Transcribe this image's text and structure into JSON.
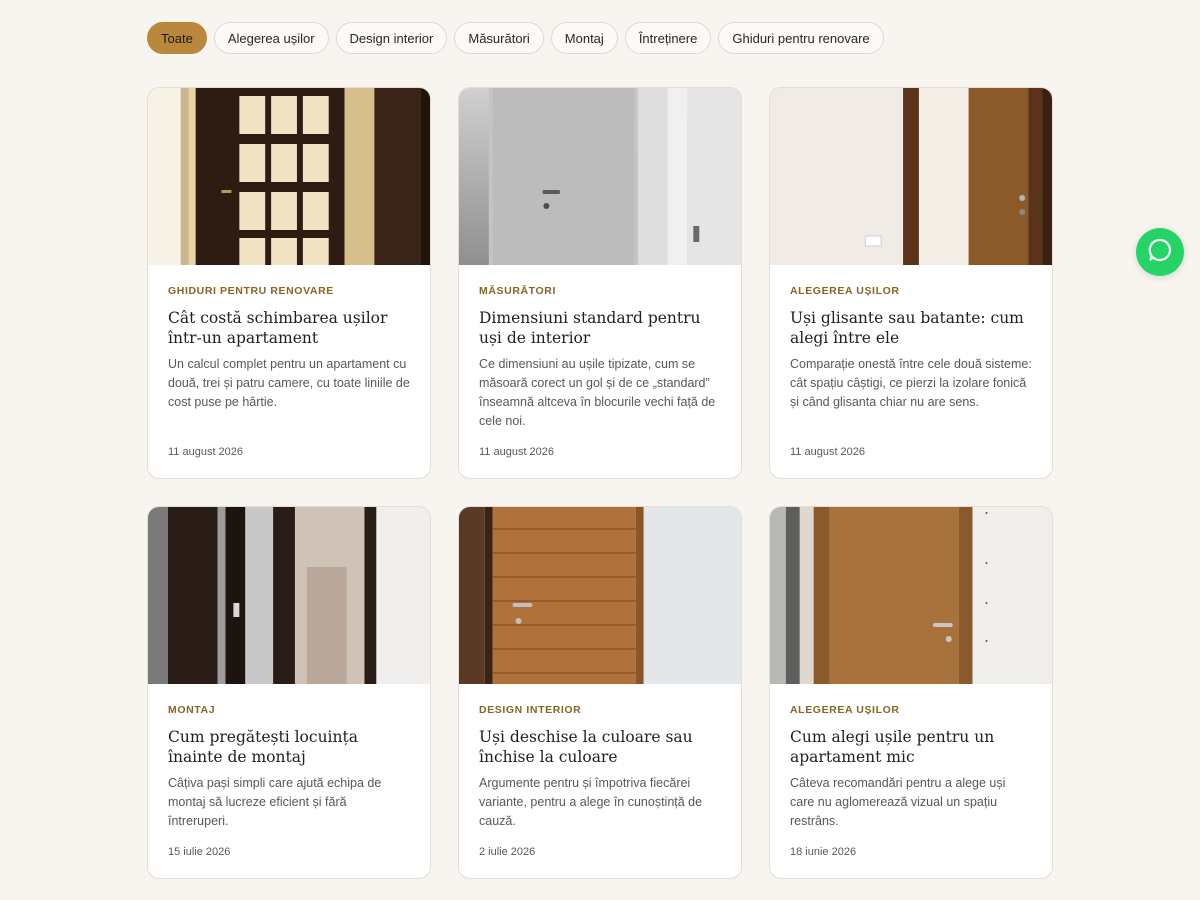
{
  "filters": [
    {
      "label": "Toate",
      "active": true
    },
    {
      "label": "Alegerea ușilor",
      "active": false
    },
    {
      "label": "Design interior",
      "active": false
    },
    {
      "label": "Măsurători",
      "active": false
    },
    {
      "label": "Montaj",
      "active": false
    },
    {
      "label": "Întreținere",
      "active": false
    },
    {
      "label": "Ghiduri pentru renovare",
      "active": false
    }
  ],
  "articles": [
    {
      "category": "GHIDURI PENTRU RENOVARE",
      "title": "Cât costă schimbarea ușilor într-un apartament",
      "excerpt": "Un calcul complet pentru un apartament cu două, trei și patru camere, cu toate liniile de cost puse pe hârtie.",
      "date": "11 august 2026",
      "image": "dark-wood-glass-door"
    },
    {
      "category": "MĂSURĂTORI",
      "title": "Dimensiuni standard pentru uși de interior",
      "excerpt": "Ce dimensiuni au ușile tipizate, cum se măsoară corect un gol și de ce „standard” înseamnă altceva în blocurile vechi față de cele noi.",
      "date": "11 august 2026",
      "image": "white-door"
    },
    {
      "category": "ALEGEREA UȘILOR",
      "title": "Uși glisante sau batante: cum alegi între ele",
      "excerpt": "Comparație onestă între cele două sisteme: cât spațiu câștigi, ce pierzi la izolare fonică și când glisanta chiar nu are sens.",
      "date": "11 august 2026",
      "image": "wood-door-corner"
    },
    {
      "category": "MONTAJ",
      "title": "Cum pregătești locuința înainte de montaj",
      "excerpt": "Câțiva pași simpli care ajută echipa de montaj să lucreze eficient și fără întreruperi.",
      "date": "15 iulie 2026",
      "image": "glass-sliding-door"
    },
    {
      "category": "DESIGN INTERIOR",
      "title": "Uși deschise la culoare sau închise la culoare",
      "excerpt": "Argumente pentru și împotriva fiecărei variante, pentru a alege în cunoștință de cauză.",
      "date": "2 iulie 2026",
      "image": "horizontal-oak-door"
    },
    {
      "category": "ALEGEREA UȘILOR",
      "title": "Cum alegi ușile pentru un apartament mic",
      "excerpt": "Câteva recomandări pentru a alege uși care nu aglomerează vizual un spațiu restrâns.",
      "date": "18 iunie 2026",
      "image": "oak-door"
    }
  ],
  "whatsapp_button": {
    "icon": "whatsapp-chat-icon",
    "color": "#25d366"
  },
  "colors": {
    "accent": "#b9883c",
    "category": "#8a6424",
    "background": "#f8f5f0"
  }
}
